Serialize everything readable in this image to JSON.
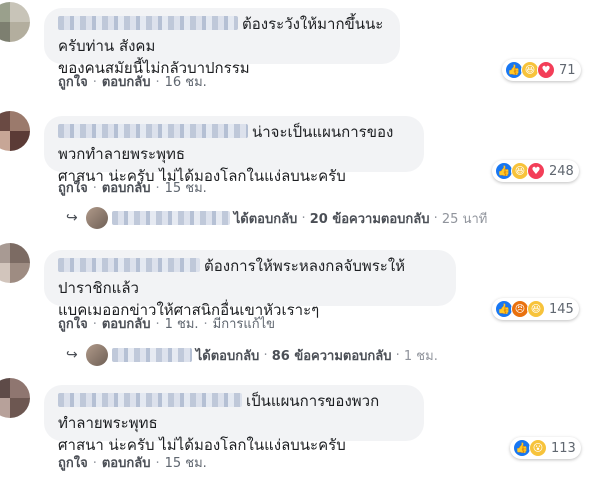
{
  "comments": [
    {
      "text_line1": "ต้องระวังให้มากขึ้นนะครับท่าน สังคม",
      "text_line2": "ของคนสมัยนี้ไม่กลัวบาปกรรม",
      "like": "ถูกใจ",
      "reply": "ตอบกลับ",
      "time": "16 ชม.",
      "reactions": [
        "like-icon",
        "haha-icon",
        "love-icon"
      ],
      "count": "71"
    },
    {
      "text_line1": "น่าจะเป็นแผนการของพวกทำลายพระพุทธ",
      "text_line2": "ศาสนา น่ะครับ ไม่ได้มองโลกในแง่ลบนะครับ",
      "like": "ถูกใจ",
      "reply": "ตอบกลับ",
      "time": "15 ชม.",
      "reactions": [
        "like-icon",
        "haha-icon",
        "love-icon"
      ],
      "count": "248",
      "replies": {
        "label": "ได้ตอบกลับ",
        "count_text": "20 ข้อความตอบกลับ",
        "time": "25 นาที"
      }
    },
    {
      "text_line1": "ต้องการให้พระหลงกลจับพระให้ปาราชิกแล้ว",
      "text_line2": "แบคเมออกข่าวให้ศาสนิกอื่นเขาหัวเราะๆ",
      "like": "ถูกใจ",
      "reply": "ตอบกลับ",
      "time": "1 ชม.",
      "edited": "มีการแก้ไข",
      "reactions": [
        "like-icon",
        "angry-icon",
        "haha-icon"
      ],
      "count": "145",
      "replies": {
        "label": "ได้ตอบกลับ",
        "count_text": "86 ข้อความตอบกลับ",
        "time": "1 ชม."
      }
    },
    {
      "text_line1": "เป็นแผนการของพวกทำลายพระพุทธ",
      "text_line2": "ศาสนา น่ะครับ ไม่ได้มองโลกในแง่ลบนะครับ",
      "like": "ถูกใจ",
      "reply": "ตอบกลับ",
      "time": "15 ชม.",
      "reactions": [
        "like-icon",
        "wow-icon"
      ],
      "count": "113"
    }
  ],
  "colors": {
    "bubble": "#f2f3f5",
    "link": "#4b4f56",
    "like_blue": "#1877f2"
  }
}
